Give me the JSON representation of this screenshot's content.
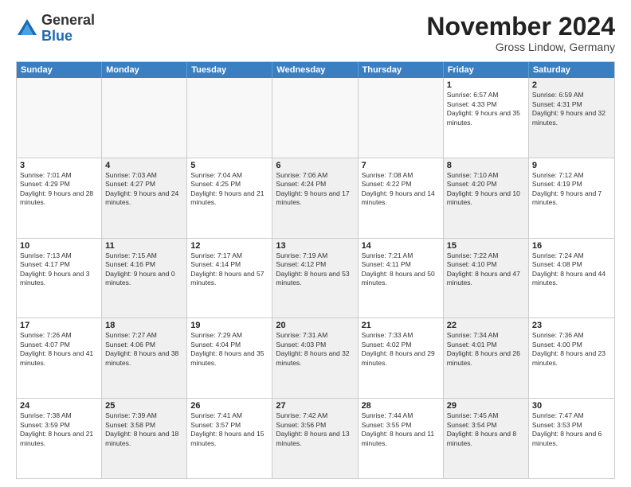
{
  "header": {
    "logo_general": "General",
    "logo_blue": "Blue",
    "month_title": "November 2024",
    "subtitle": "Gross Lindow, Germany"
  },
  "calendar": {
    "days_of_week": [
      "Sunday",
      "Monday",
      "Tuesday",
      "Wednesday",
      "Thursday",
      "Friday",
      "Saturday"
    ],
    "rows": [
      [
        {
          "day": "",
          "text": "",
          "empty": true
        },
        {
          "day": "",
          "text": "",
          "empty": true
        },
        {
          "day": "",
          "text": "",
          "empty": true
        },
        {
          "day": "",
          "text": "",
          "empty": true
        },
        {
          "day": "",
          "text": "",
          "empty": true
        },
        {
          "day": "1",
          "text": "Sunrise: 6:57 AM\nSunset: 4:33 PM\nDaylight: 9 hours and 35 minutes.",
          "shaded": false
        },
        {
          "day": "2",
          "text": "Sunrise: 6:59 AM\nSunset: 4:31 PM\nDaylight: 9 hours and 32 minutes.",
          "shaded": true
        }
      ],
      [
        {
          "day": "3",
          "text": "Sunrise: 7:01 AM\nSunset: 4:29 PM\nDaylight: 9 hours and 28 minutes.",
          "shaded": false
        },
        {
          "day": "4",
          "text": "Sunrise: 7:03 AM\nSunset: 4:27 PM\nDaylight: 9 hours and 24 minutes.",
          "shaded": true
        },
        {
          "day": "5",
          "text": "Sunrise: 7:04 AM\nSunset: 4:25 PM\nDaylight: 9 hours and 21 minutes.",
          "shaded": false
        },
        {
          "day": "6",
          "text": "Sunrise: 7:06 AM\nSunset: 4:24 PM\nDaylight: 9 hours and 17 minutes.",
          "shaded": true
        },
        {
          "day": "7",
          "text": "Sunrise: 7:08 AM\nSunset: 4:22 PM\nDaylight: 9 hours and 14 minutes.",
          "shaded": false
        },
        {
          "day": "8",
          "text": "Sunrise: 7:10 AM\nSunset: 4:20 PM\nDaylight: 9 hours and 10 minutes.",
          "shaded": true
        },
        {
          "day": "9",
          "text": "Sunrise: 7:12 AM\nSunset: 4:19 PM\nDaylight: 9 hours and 7 minutes.",
          "shaded": false
        }
      ],
      [
        {
          "day": "10",
          "text": "Sunrise: 7:13 AM\nSunset: 4:17 PM\nDaylight: 9 hours and 3 minutes.",
          "shaded": false
        },
        {
          "day": "11",
          "text": "Sunrise: 7:15 AM\nSunset: 4:16 PM\nDaylight: 9 hours and 0 minutes.",
          "shaded": true
        },
        {
          "day": "12",
          "text": "Sunrise: 7:17 AM\nSunset: 4:14 PM\nDaylight: 8 hours and 57 minutes.",
          "shaded": false
        },
        {
          "day": "13",
          "text": "Sunrise: 7:19 AM\nSunset: 4:12 PM\nDaylight: 8 hours and 53 minutes.",
          "shaded": true
        },
        {
          "day": "14",
          "text": "Sunrise: 7:21 AM\nSunset: 4:11 PM\nDaylight: 8 hours and 50 minutes.",
          "shaded": false
        },
        {
          "day": "15",
          "text": "Sunrise: 7:22 AM\nSunset: 4:10 PM\nDaylight: 8 hours and 47 minutes.",
          "shaded": true
        },
        {
          "day": "16",
          "text": "Sunrise: 7:24 AM\nSunset: 4:08 PM\nDaylight: 8 hours and 44 minutes.",
          "shaded": false
        }
      ],
      [
        {
          "day": "17",
          "text": "Sunrise: 7:26 AM\nSunset: 4:07 PM\nDaylight: 8 hours and 41 minutes.",
          "shaded": false
        },
        {
          "day": "18",
          "text": "Sunrise: 7:27 AM\nSunset: 4:06 PM\nDaylight: 8 hours and 38 minutes.",
          "shaded": true
        },
        {
          "day": "19",
          "text": "Sunrise: 7:29 AM\nSunset: 4:04 PM\nDaylight: 8 hours and 35 minutes.",
          "shaded": false
        },
        {
          "day": "20",
          "text": "Sunrise: 7:31 AM\nSunset: 4:03 PM\nDaylight: 8 hours and 32 minutes.",
          "shaded": true
        },
        {
          "day": "21",
          "text": "Sunrise: 7:33 AM\nSunset: 4:02 PM\nDaylight: 8 hours and 29 minutes.",
          "shaded": false
        },
        {
          "day": "22",
          "text": "Sunrise: 7:34 AM\nSunset: 4:01 PM\nDaylight: 8 hours and 26 minutes.",
          "shaded": true
        },
        {
          "day": "23",
          "text": "Sunrise: 7:36 AM\nSunset: 4:00 PM\nDaylight: 8 hours and 23 minutes.",
          "shaded": false
        }
      ],
      [
        {
          "day": "24",
          "text": "Sunrise: 7:38 AM\nSunset: 3:59 PM\nDaylight: 8 hours and 21 minutes.",
          "shaded": false
        },
        {
          "day": "25",
          "text": "Sunrise: 7:39 AM\nSunset: 3:58 PM\nDaylight: 8 hours and 18 minutes.",
          "shaded": true
        },
        {
          "day": "26",
          "text": "Sunrise: 7:41 AM\nSunset: 3:57 PM\nDaylight: 8 hours and 15 minutes.",
          "shaded": false
        },
        {
          "day": "27",
          "text": "Sunrise: 7:42 AM\nSunset: 3:56 PM\nDaylight: 8 hours and 13 minutes.",
          "shaded": true
        },
        {
          "day": "28",
          "text": "Sunrise: 7:44 AM\nSunset: 3:55 PM\nDaylight: 8 hours and 11 minutes.",
          "shaded": false
        },
        {
          "day": "29",
          "text": "Sunrise: 7:45 AM\nSunset: 3:54 PM\nDaylight: 8 hours and 8 minutes.",
          "shaded": true
        },
        {
          "day": "30",
          "text": "Sunrise: 7:47 AM\nSunset: 3:53 PM\nDaylight: 8 hours and 6 minutes.",
          "shaded": false
        }
      ]
    ]
  }
}
